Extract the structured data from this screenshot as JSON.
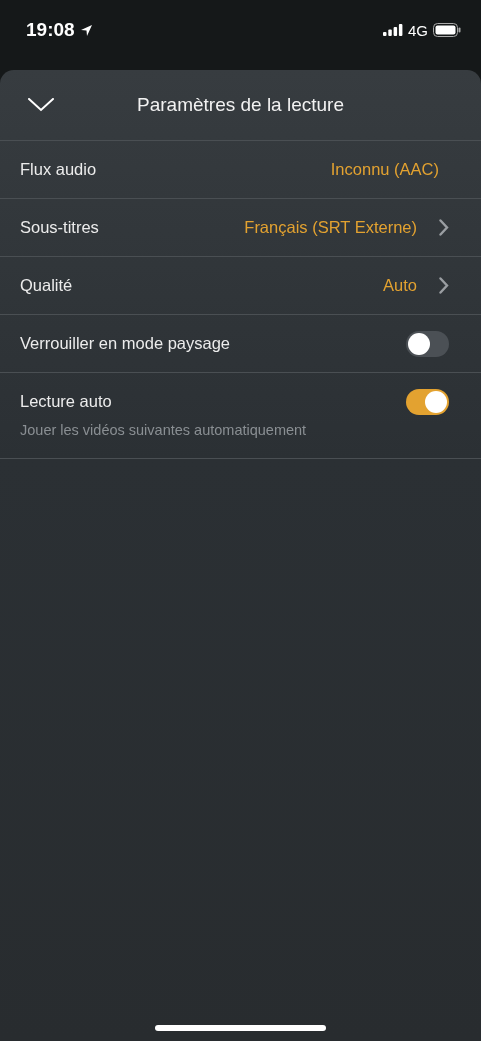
{
  "status_bar": {
    "time": "19:08",
    "network": "4G"
  },
  "sheet": {
    "title": "Paramètres de la lecture"
  },
  "rows": [
    {
      "kind": "value",
      "label": "Flux audio",
      "value": "Inconnu (AAC)",
      "chevron": false
    },
    {
      "kind": "value",
      "label": "Sous-titres",
      "value": "Français (SRT Externe)",
      "chevron": true
    },
    {
      "kind": "value",
      "label": "Qualité",
      "value": "Auto",
      "chevron": true
    },
    {
      "kind": "toggle",
      "label": "Verrouiller en mode paysage",
      "on": false
    },
    {
      "kind": "toggle",
      "label": "Lecture auto",
      "on": true,
      "description": "Jouer les vidéos suivantes automatiquement"
    }
  ]
}
